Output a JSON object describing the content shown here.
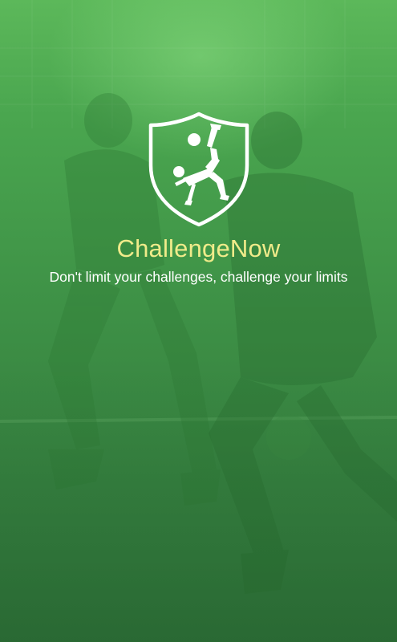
{
  "splash": {
    "app_name": "ChallengeNow",
    "tagline": "Don't limit your challenges, challenge your limits",
    "logo_icon": "shield-bicycle-kick-icon",
    "background": "football-players-photo"
  },
  "colors": {
    "background_top": "#5cb85a",
    "background_bottom": "#2f7239",
    "title": "#f0eb8a",
    "tagline": "#ffffff",
    "logo": "#ffffff"
  }
}
